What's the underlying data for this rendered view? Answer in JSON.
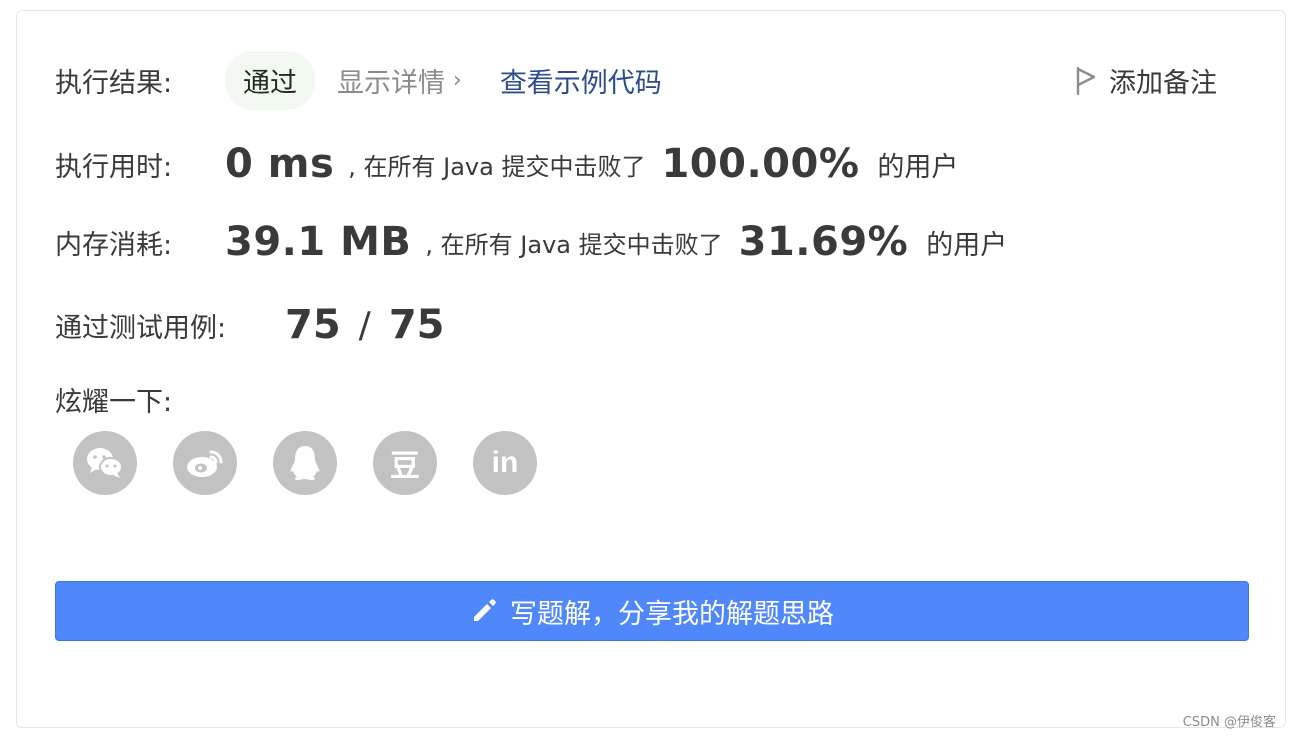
{
  "result": {
    "label": "执行结果:",
    "status": "通过",
    "details_label": "显示详情",
    "example_link": "查看示例代码",
    "note_label": "添加备注"
  },
  "runtime": {
    "label": "执行用时:",
    "value": "0 ms",
    "beat_text": ", 在所有 Java 提交中击败了",
    "percent": "100.00%",
    "tail": "的用户"
  },
  "memory": {
    "label": "内存消耗:",
    "value": "39.1 MB",
    "beat_text": ", 在所有 Java 提交中击败了",
    "percent": "31.69%",
    "tail": "的用户"
  },
  "tests": {
    "label": "通过测试用例:",
    "passed": "75",
    "separator": "/",
    "total": "75"
  },
  "share": {
    "label": "炫耀一下:",
    "icons": [
      "wechat-icon",
      "weibo-icon",
      "qq-icon",
      "douban-icon",
      "linkedin-icon"
    ],
    "douban_glyph": "豆",
    "linkedin_glyph": "in"
  },
  "write_solution": {
    "label": "写题解，分享我的解题思路"
  },
  "watermark": "CSDN @伊俊客",
  "colors": {
    "primary_button": "#5087fb",
    "link": "#2c4c8c",
    "pass_badge_bg": "#f2f9f1",
    "share_icon_bg": "#c2c2c2"
  }
}
